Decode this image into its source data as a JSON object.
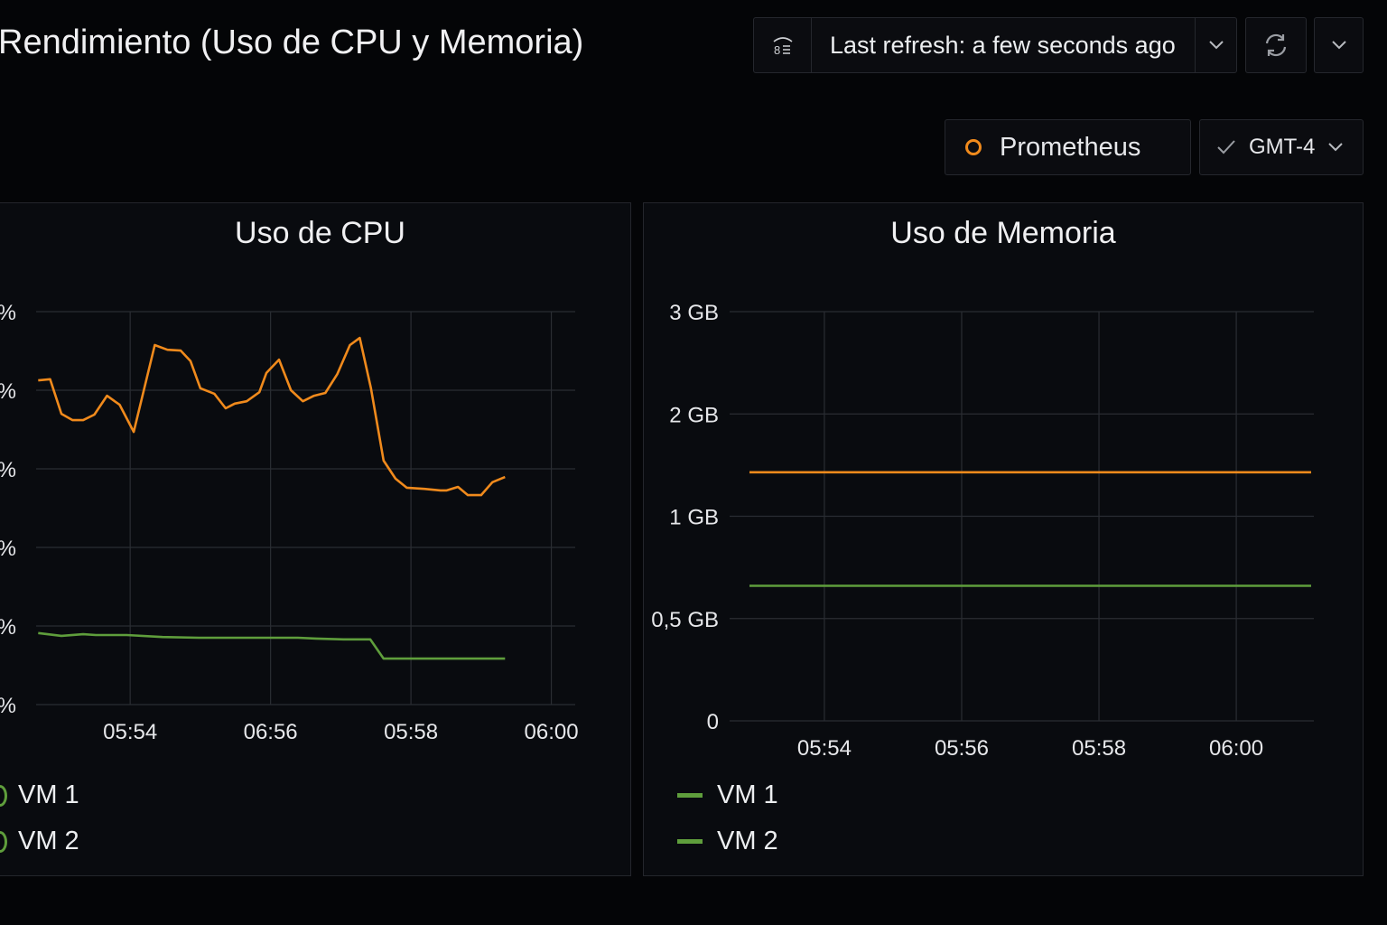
{
  "header": {
    "title": "Rendimiento (Uso de CPU y Memoria)",
    "refresh_label": "Last refresh: a few seconds ago",
    "datasource": "Prometheus",
    "timezone": "GMT-4"
  },
  "colors": {
    "orange": "#f08a1c",
    "green": "#5f9e3c",
    "grid": "#2a2d33"
  },
  "chart_data": [
    {
      "type": "line",
      "title": "Uso de CPU",
      "xlabel": "",
      "ylabel": "",
      "x_unit": "minutes (05:xx)",
      "xlim": [
        52.66,
        60.34
      ],
      "ylim": [
        0,
        100
      ],
      "yticks": [
        0,
        20,
        40,
        60,
        80,
        100
      ],
      "ytick_labels": [
        "%",
        "%",
        "%",
        "%",
        "%",
        "%"
      ],
      "xticks": [
        54,
        56,
        58,
        60
      ],
      "xtick_labels": [
        "05:54",
        "06:56",
        "05:58",
        "06:00"
      ],
      "grid": true,
      "legend": [
        "VM 1",
        "VM 2"
      ],
      "legend_placement": "bottom-left",
      "series": [
        {
          "name": "orange-series",
          "color": "#f08a1c",
          "x": [
            52.69,
            52.86,
            53.02,
            53.18,
            53.33,
            53.49,
            53.67,
            53.85,
            54.05,
            54.35,
            54.53,
            54.72,
            54.86,
            55.0,
            55.2,
            55.36,
            55.49,
            55.66,
            55.84,
            55.94,
            56.12,
            56.29,
            56.46,
            56.62,
            56.78,
            56.95,
            57.13,
            57.27,
            57.43,
            57.61,
            57.78,
            57.94,
            58.19,
            58.42,
            58.51,
            58.67,
            58.81,
            59.0,
            59.16,
            59.34
          ],
          "y": [
            82.5,
            82.8,
            74.0,
            72.4,
            72.4,
            73.8,
            78.6,
            76.3,
            69.4,
            91.5,
            90.3,
            90.1,
            87.4,
            80.5,
            79.1,
            75.4,
            76.6,
            77.2,
            79.5,
            84.4,
            87.8,
            80.0,
            77.2,
            78.6,
            79.3,
            84.1,
            91.5,
            93.3,
            80.5,
            62.1,
            57.5,
            55.2,
            54.9,
            54.5,
            54.5,
            55.4,
            53.3,
            53.3,
            56.6,
            57.9
          ]
        },
        {
          "name": "green-series",
          "color": "#5f9e3c",
          "x": [
            52.69,
            53.02,
            53.33,
            53.51,
            53.95,
            54.46,
            54.98,
            55.49,
            56.01,
            56.39,
            56.65,
            57.04,
            57.42,
            57.61,
            58.06,
            58.58,
            59.34
          ],
          "y": [
            18.2,
            17.5,
            17.9,
            17.7,
            17.7,
            17.2,
            17.0,
            17.0,
            17.0,
            17.0,
            16.8,
            16.6,
            16.6,
            11.7,
            11.7,
            11.7,
            11.7
          ]
        }
      ]
    },
    {
      "type": "line",
      "title": "Uso de Memoria",
      "xlabel": "",
      "ylabel": "",
      "xlim": [
        52.62,
        61.13
      ],
      "yticks": [
        0,
        0.5,
        1,
        2,
        3
      ],
      "ytick_labels": [
        "0",
        "0,5 GB",
        "1 GB",
        "2 GB",
        "3 GB"
      ],
      "xticks": [
        54,
        56,
        58,
        60
      ],
      "xtick_labels": [
        "05:54",
        "05:56",
        "05:58",
        "06:00"
      ],
      "grid": true,
      "legend": [
        "VM 1",
        "VM 2"
      ],
      "legend_placement": "bottom-left",
      "series": [
        {
          "name": "orange-series",
          "color": "#f08a1c",
          "x": [
            52.91,
            61.09
          ],
          "y": [
            1.43,
            1.43
          ]
        },
        {
          "name": "green-series",
          "color": "#5f9e3c",
          "x": [
            52.91,
            61.09
          ],
          "y": [
            0.66,
            0.66
          ]
        }
      ]
    }
  ]
}
